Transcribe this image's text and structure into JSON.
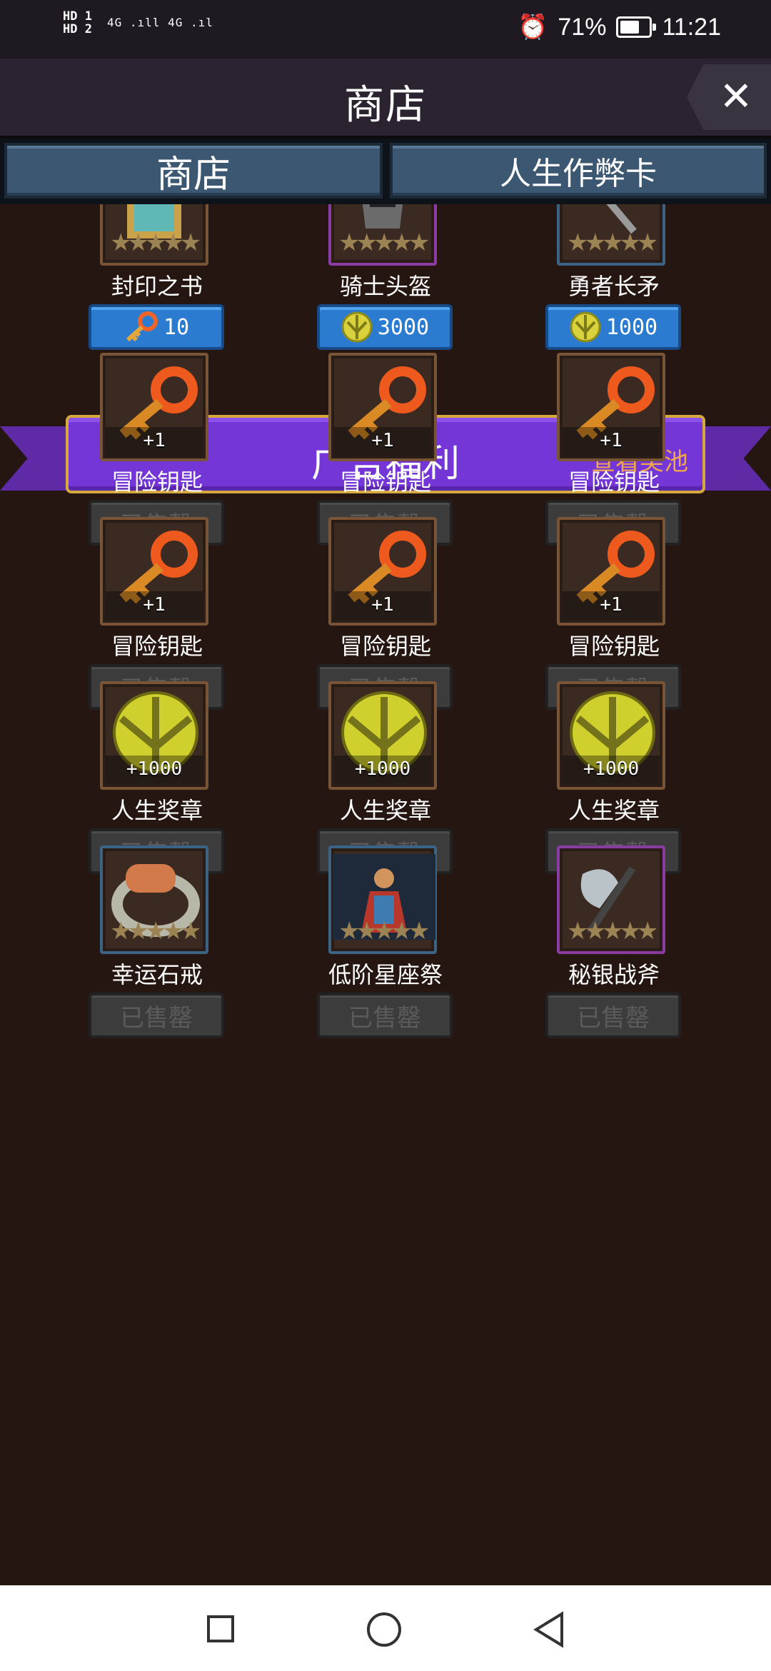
{
  "status_bar": {
    "sim_labels": "HD 1\nHD 2",
    "signal": "4G .ıll 4G .ıl",
    "battery": "71%",
    "time": "11:21"
  },
  "header": {
    "title": "商店",
    "close_label": "✕"
  },
  "tabs": [
    {
      "label": "商店"
    },
    {
      "label": "人生作弊卡"
    }
  ],
  "top_items": [
    {
      "name": "封印之书",
      "price": "10",
      "currency_icon": "key-icon",
      "frame": "orange"
    },
    {
      "name": "骑士头盔",
      "price": "3000",
      "currency_icon": "medal-icon",
      "frame": "purple"
    },
    {
      "name": "勇者长矛",
      "price": "1000",
      "currency_icon": "medal-icon",
      "frame": "blue"
    }
  ],
  "banner": {
    "title": "广告福利",
    "view_pool": "查看奖池"
  },
  "ad_items": [
    {
      "name": "冒险钥匙",
      "amount": "+1",
      "icon": "key-icon",
      "button": "已售罄"
    },
    {
      "name": "冒险钥匙",
      "amount": "+1",
      "icon": "key-icon",
      "button": "已售罄"
    },
    {
      "name": "冒险钥匙",
      "amount": "+1",
      "icon": "key-icon",
      "button": "已售罄"
    },
    {
      "name": "冒险钥匙",
      "amount": "+1",
      "icon": "key-icon",
      "button": "已售罄"
    },
    {
      "name": "冒险钥匙",
      "amount": "+1",
      "icon": "key-icon",
      "button": "已售罄"
    },
    {
      "name": "冒险钥匙",
      "amount": "+1",
      "icon": "key-icon",
      "button": "已售罄"
    },
    {
      "name": "人生奖章",
      "amount": "+1000",
      "icon": "medal-icon",
      "button": "已售罄"
    },
    {
      "name": "人生奖章",
      "amount": "+1000",
      "icon": "medal-icon",
      "button": "已售罄"
    },
    {
      "name": "人生奖章",
      "amount": "+1000",
      "icon": "medal-icon",
      "button": "已售罄"
    },
    {
      "name": "幸运石戒",
      "amount": "",
      "icon": "ring-icon",
      "button": "已售罄"
    },
    {
      "name": "低阶星座祭",
      "amount": "",
      "icon": "hero-icon",
      "button": "已售罄"
    },
    {
      "name": "秘银战斧",
      "amount": "",
      "icon": "axe-icon",
      "button": "已售罄"
    }
  ],
  "colors": {
    "background": "#261612",
    "price_button": "#2b7cd1",
    "banner": "#7436d6",
    "view_pool_text": "#f0a84a",
    "sold_button": "#3c3c3c"
  }
}
